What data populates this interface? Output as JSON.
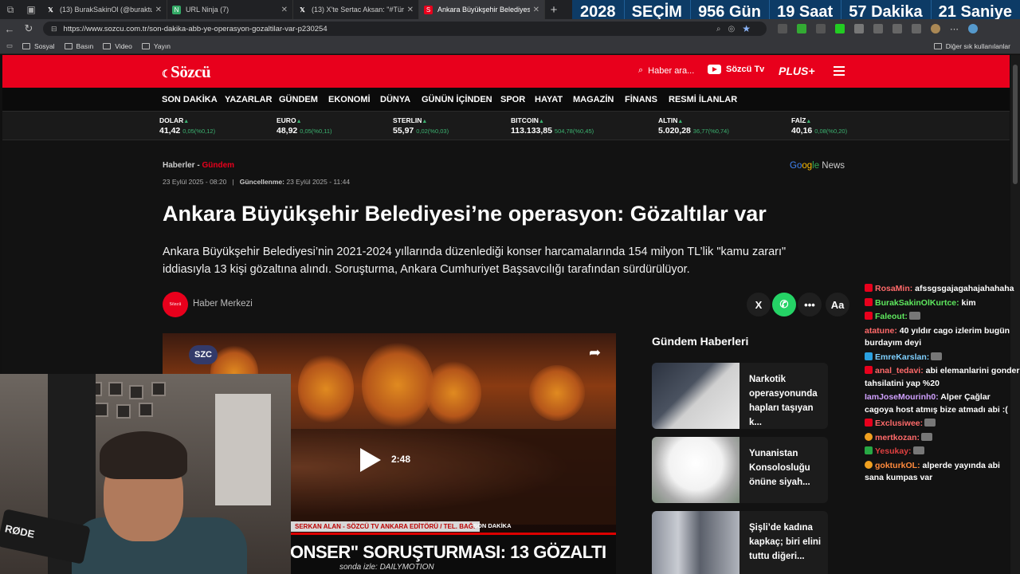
{
  "browser": {
    "tabs": [
      {
        "title": "(13) BurakSakinOl (@buraktut_) /",
        "icon": "x-logo-icon",
        "active": false
      },
      {
        "title": "URL Ninja (7)",
        "icon": "ninja-icon",
        "active": false
      },
      {
        "title": "(13) X'te Sertac Aksan: \"#Türkiye",
        "icon": "x-logo-icon",
        "active": false
      },
      {
        "title": "Ankara Büyükşehir Belediyesi'ne o",
        "icon": "sozcu-icon",
        "active": true
      }
    ],
    "new_tab": "+",
    "url": "https://www.sozcu.com.tr/son-dakika-abb-ye-operasyon-gozaltilar-var-p230254",
    "bookmarks": [
      "Sosyal",
      "Basın",
      "Video",
      "Yayın"
    ],
    "bookmarks_right": "Diğer sık kullanılanlar"
  },
  "countdown": {
    "items": [
      "2028",
      "SEÇİM",
      "956 Gün",
      "19 Saat",
      "57 Dakika",
      "21 Saniye"
    ],
    "bg_color": "#0d3b66"
  },
  "site": {
    "logo": "Sözcü",
    "search_placeholder": "Haber ara...",
    "tv_label": "Sözcü Tv",
    "plus_label": "PLUS+",
    "brand_color": "#e8001c",
    "nav": [
      "SON DAKİKA",
      "YAZARLAR",
      "GÜNDEM",
      "EKONOMİ",
      "DÜNYA",
      "GÜNÜN İÇİNDEN",
      "SPOR",
      "HAYAT",
      "MAGAZİN",
      "FİNANS",
      "RESMİ İLANLAR"
    ],
    "ticker": [
      {
        "name": "DOLAR",
        "value": "41,42",
        "change": "0,05(%0,12)"
      },
      {
        "name": "EURO",
        "value": "48,92",
        "change": "0,05(%0,11)"
      },
      {
        "name": "STERLIN",
        "value": "55,97",
        "change": "0,02(%0,03)"
      },
      {
        "name": "BITCOIN",
        "value": "113.133,85",
        "change": "504,78(%0,45)"
      },
      {
        "name": "ALTIN",
        "value": "5.020,28",
        "change": "36,77(%0,74)"
      },
      {
        "name": "FAİZ",
        "value": "40,16",
        "change": "0,08(%0,20)"
      }
    ]
  },
  "article": {
    "breadcrumb_root": "Haberler -",
    "breadcrumb_cat": "Gündem",
    "google_news": [
      "Go",
      "og",
      "le",
      " News"
    ],
    "published": "23 Eylül 2025 - 08:20",
    "separator": "|",
    "updated_label": "Güncellenme:",
    "updated": "23 Eylül 2025 - 11:44",
    "headline": "Ankara Büyükşehir Belediyesi’ne operasyon: Gözaltılar var",
    "spot": "Ankara Büyükşehir Belediyesi’nin 2021-2024 yıllarında düzenlediği konser harcamalarında 154 milyon TL’lik \"kamu zararı\" iddiasıyla 13 kişi gözaltına alındı. Soruşturma, Ankara Cumhuriyet Başsavcılığı tarafından sürdürülüyor.",
    "author_avatar_text": "Sözcü",
    "author": "Haber Merkezi",
    "share": [
      "X",
      "",
      "•••",
      "Aa"
    ]
  },
  "video": {
    "channel_badge": "SZC",
    "duration": "2:48",
    "lower_name": "SERKAN ALAN - SÖZCÜ TV ANKARA EDİTÖRÜ / TEL. BAĞ.",
    "lower_tag": "SON DAKİKA",
    "lower_title": "ONSER\" SORUŞTURMASI: 13 GÖZALTI",
    "lower_sub": "sonda izle: DAILYMOTION"
  },
  "sidebar": {
    "heading": "Gündem Haberleri",
    "cards": [
      {
        "title": "Narkotik operasyonunda hapları taşıyan k..."
      },
      {
        "title": "Yunanistan Konsolosluğu önüne siyah..."
      },
      {
        "title": "Şişli’de kadına kapkaç; biri elini tuttu diğeri..."
      }
    ]
  },
  "webcam": {
    "mic_brand": "RØDE"
  },
  "chat": [
    {
      "user": "RosaMin:",
      "text": "afssgsgajagahajahahaha",
      "user_color": "#ff6a6a",
      "badge": "r"
    },
    {
      "user": "BurakSakinOlKurtce:",
      "text": "kim",
      "user_color": "#5ee85e",
      "badge": "r"
    },
    {
      "user": "Faleout:",
      "text": "",
      "user_color": "#5ee85e",
      "badge": "r",
      "emote": true
    },
    {
      "user": "atatune:",
      "text": "40 yıldır cago izlerim bugün burdayım deyi",
      "user_color": "#ff6a6a",
      "badge": ""
    },
    {
      "user": "EmreKarslan:",
      "text": "",
      "user_color": "#7fd0ff",
      "badge": "b",
      "emote": true
    },
    {
      "user": "anal_tedavi:",
      "text": "abi elemanlarini gonder tahsilatini yap %20",
      "user_color": "#ff6a6a",
      "badge": "r"
    },
    {
      "user": "IamJoseMourinh0:",
      "text": "Alper Çağlar cagoya host atmış bize atmadı abi :(",
      "user_color": "#d0a0ff",
      "badge": ""
    },
    {
      "user": "Exclusiwee:",
      "text": "",
      "user_color": "#ff6a6a",
      "badge": "r",
      "emote": true
    },
    {
      "user": "mertkozan:",
      "text": "",
      "user_color": "#ff6a6a",
      "badge": "y",
      "emote": true
    },
    {
      "user": "Yesukay:",
      "text": "",
      "user_color": "#e04040",
      "badge": "g",
      "emote": true
    },
    {
      "user": "gokturkOL:",
      "text": "alperde yayında abi sana kumpas var",
      "user_color": "#ff8a3c",
      "badge": "y"
    }
  ]
}
